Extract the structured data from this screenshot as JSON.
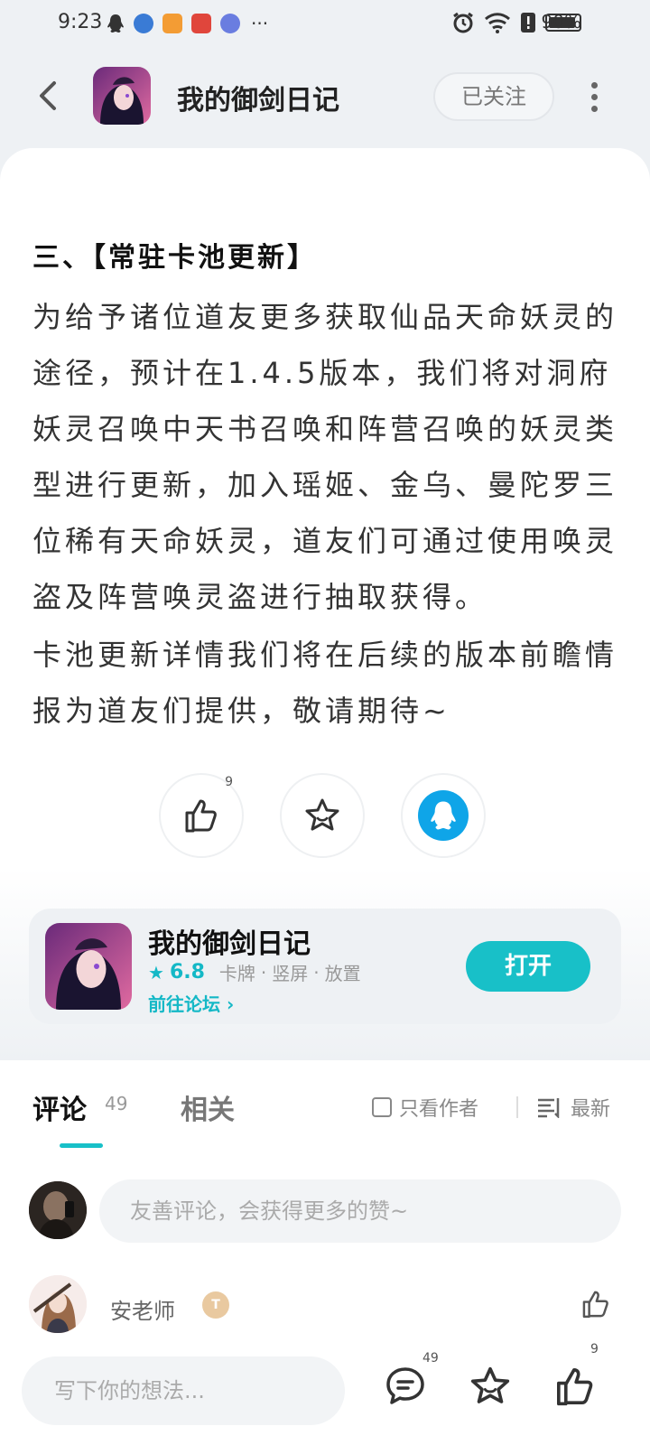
{
  "status_bar": {
    "time": "9:23",
    "dots": "···",
    "battery_percent": "90%",
    "battery_level": 0.9
  },
  "header": {
    "title": "我的御剑日记",
    "follow_label": "已关注"
  },
  "article": {
    "section_title": "三、【常驻卡池更新】",
    "paragraph1": "为给予诸位道友更多获取仙品天命妖灵的途径，预计在1.4.5版本，我们将对洞府妖灵召唤中天书召唤和阵营召唤的妖灵类型进行更新，加入瑶姬、金乌、曼陀罗三位稀有天命妖灵，道友们可通过使用唤灵盗及阵营唤灵盗进行抽取获得。",
    "paragraph2": "卡池更新详情我们将在后续的版本前瞻情报为道友们提供，敬请期待~"
  },
  "actions": {
    "like_count": "9"
  },
  "app_card": {
    "name": "我的御剑日记",
    "rating": "6.8",
    "tags": [
      "卡牌",
      "竖屏",
      "放置"
    ],
    "tag_separator": "·",
    "forum_link": "前往论坛",
    "forum_arrow": "›",
    "open_label": "打开"
  },
  "comments": {
    "tab_comment": "评论",
    "comment_count": "49",
    "tab_related": "相关",
    "only_author": "只看作者",
    "sort_label": "最新",
    "input_placeholder": "友善评论，会获得更多的赞~",
    "first": {
      "user": "安老师",
      "badge": "T"
    }
  },
  "bottom_bar": {
    "placeholder": "写下你的想法...",
    "comment_count": "49",
    "like_count": "9"
  },
  "colors": {
    "accent": "#18c0c8",
    "qq_blue": "#0fa5e8",
    "background": "#eef1f4"
  }
}
